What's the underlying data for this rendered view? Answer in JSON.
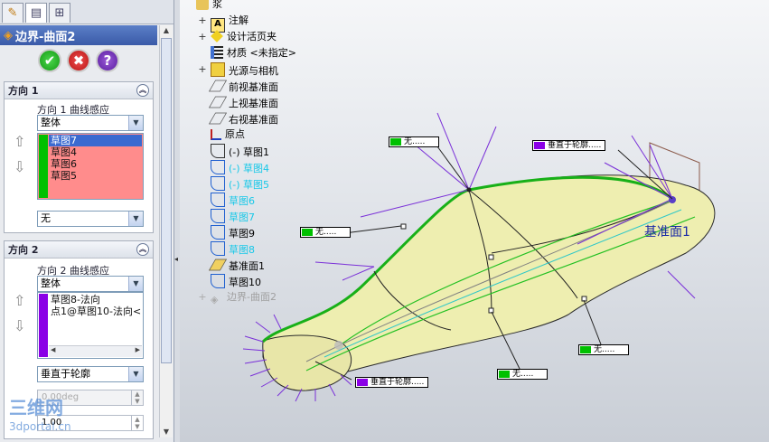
{
  "panel": {
    "title": "边界-曲面2",
    "dir1": {
      "heading": "方向 1",
      "curve_influence_label": "方向 1 曲线感应",
      "influence_value": "整体",
      "items": [
        "草图7",
        "草图4",
        "草图6",
        "草图5"
      ],
      "selected_index": 0,
      "tangency_value": "无"
    },
    "dir2": {
      "heading": "方向 2",
      "curve_influence_label": "方向 2 曲线感应",
      "influence_value": "整体",
      "items": [
        "草图8-法向",
        "点1@草图10-法向<"
      ],
      "tangency_value": "垂直于轮廓",
      "angle_value": "0.00deg",
      "length_value": "1.00"
    },
    "colors": {
      "dir1_bar": "#00c000",
      "dir2_bar": "#8a00e6",
      "list_bg": "#ff8c8c",
      "selected": "#3a6ad0"
    }
  },
  "tree": {
    "root": "浆",
    "items": [
      {
        "label": "注解",
        "icon": "annotation-icon",
        "expandable": true
      },
      {
        "label": "设计活页夹",
        "icon": "design-binder-icon",
        "expandable": true
      },
      {
        "label": "材质 <未指定>",
        "icon": "material-icon",
        "expandable": false
      },
      {
        "label": "光源与相机",
        "icon": "lights-camera-icon",
        "expandable": true
      },
      {
        "label": "前视基准面",
        "icon": "plane-icon",
        "expandable": false
      },
      {
        "label": "上视基准面",
        "icon": "plane-icon",
        "expandable": false
      },
      {
        "label": "右视基准面",
        "icon": "plane-icon",
        "expandable": false
      },
      {
        "label": "原点",
        "icon": "origin-icon",
        "expandable": false
      },
      {
        "label": "(-) 草图1",
        "icon": "sketch-icon",
        "expandable": false
      },
      {
        "label": "(-) 草图4",
        "icon": "sketch-icon",
        "expandable": false,
        "highlight": true
      },
      {
        "label": "(-) 草图5",
        "icon": "sketch-icon",
        "expandable": false,
        "highlight": true
      },
      {
        "label": "草图6",
        "icon": "sketch-icon",
        "expandable": false,
        "highlight": true
      },
      {
        "label": "草图7",
        "icon": "sketch-icon",
        "expandable": false,
        "highlight": true
      },
      {
        "label": "草图9",
        "icon": "sketch-icon",
        "expandable": false
      },
      {
        "label": "草图8",
        "icon": "sketch-icon",
        "expandable": false,
        "highlight": true
      },
      {
        "label": "基准面1",
        "icon": "plane-icon",
        "expandable": false
      },
      {
        "label": "草图10",
        "icon": "sketch-icon",
        "expandable": false
      },
      {
        "label": "边界-曲面2",
        "icon": "boundary-surface-icon",
        "expandable": true,
        "greyed": true
      }
    ]
  },
  "callouts": [
    {
      "label": "无.....",
      "swatch": "#00c000"
    },
    {
      "label": "垂直于轮廓.....",
      "swatch": "#8a00e6"
    },
    {
      "label": "无.....",
      "swatch": "#00c000"
    },
    {
      "label": "无.....",
      "swatch": "#00c000"
    },
    {
      "label": "无.....",
      "swatch": "#00c000"
    },
    {
      "label": "垂直于轮廓.....",
      "swatch": "#8a00e6"
    }
  ],
  "plane_label": "基准面1",
  "watermark": {
    "line1": "三维网",
    "line2": "3dportal.cn"
  }
}
